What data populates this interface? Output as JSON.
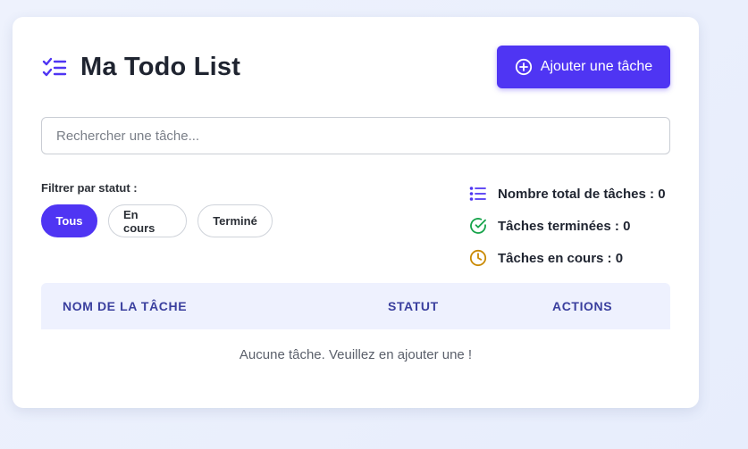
{
  "header": {
    "title": "Ma Todo List",
    "title_icon": "checklist-icon",
    "add_button_label": "Ajouter une tâche",
    "add_button_icon": "plus-circle-icon"
  },
  "search": {
    "placeholder": "Rechercher une tâche...",
    "value": ""
  },
  "filters": {
    "label": "Filtrer par statut :",
    "options": [
      "Tous",
      "En cours",
      "Terminé"
    ],
    "selected": "Tous"
  },
  "stats": {
    "total_label": "Nombre total de tâches :",
    "total_value": "0",
    "total_icon": "list-icon",
    "done_label": "Tâches terminées :",
    "done_value": "0",
    "done_icon": "check-circle-icon",
    "in_progress_label": "Tâches en cours :",
    "in_progress_value": "0",
    "in_progress_icon": "clock-icon"
  },
  "table": {
    "columns": [
      "NOM DE LA TÂCHE",
      "STATUT",
      "ACTIONS"
    ],
    "rows": [],
    "empty_message": "Aucune tâche. Veuillez en ajouter une !"
  },
  "colors": {
    "accent": "#4f35f3",
    "done_green": "#16a34a",
    "progress_amber": "#ca8a04",
    "table_header_bg": "#eef1fe"
  }
}
